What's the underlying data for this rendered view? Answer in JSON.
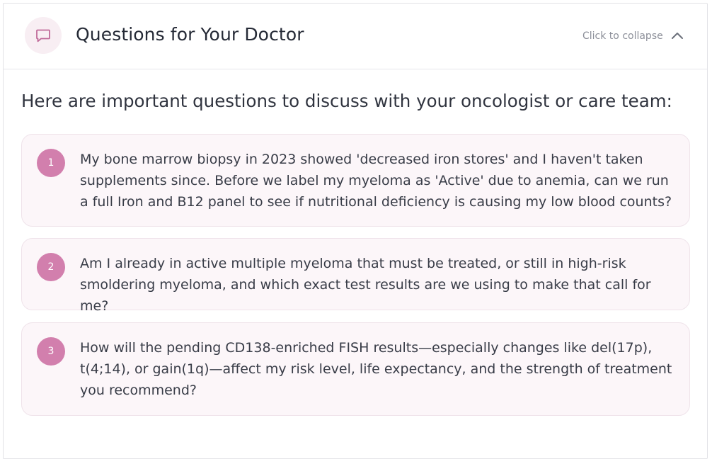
{
  "panel": {
    "title": "Questions for Your Doctor",
    "collapse_label": "Click to collapse",
    "icons": {
      "header": "chat-bubble-icon",
      "collapse": "chevron-up-icon"
    },
    "colors": {
      "accent": "#d27fad",
      "icon_bg": "#f8eef3",
      "question_bg": "#fcf6f9"
    }
  },
  "intro": "Here are important questions to discuss with your oncologist or care team:",
  "questions": [
    {
      "number": "1",
      "text": "My bone marrow biopsy in 2023 showed 'decreased iron stores' and I haven't taken supplements since. Before we label my myeloma as 'Active' due to anemia, can we run a full Iron and B12 panel to see if nutritional deficiency is causing my low blood counts?"
    },
    {
      "number": "2",
      "text": "Am I already in active multiple myeloma that must be treated, or still in high-risk smoldering myeloma, and which exact test results are we using to make that call for me?"
    },
    {
      "number": "3",
      "text": "How will the pending CD138-enriched FISH results—especially changes like del(17p), t(4;14), or gain(1q)—affect my risk level, life expectancy, and the strength of treatment you recommend?"
    }
  ]
}
